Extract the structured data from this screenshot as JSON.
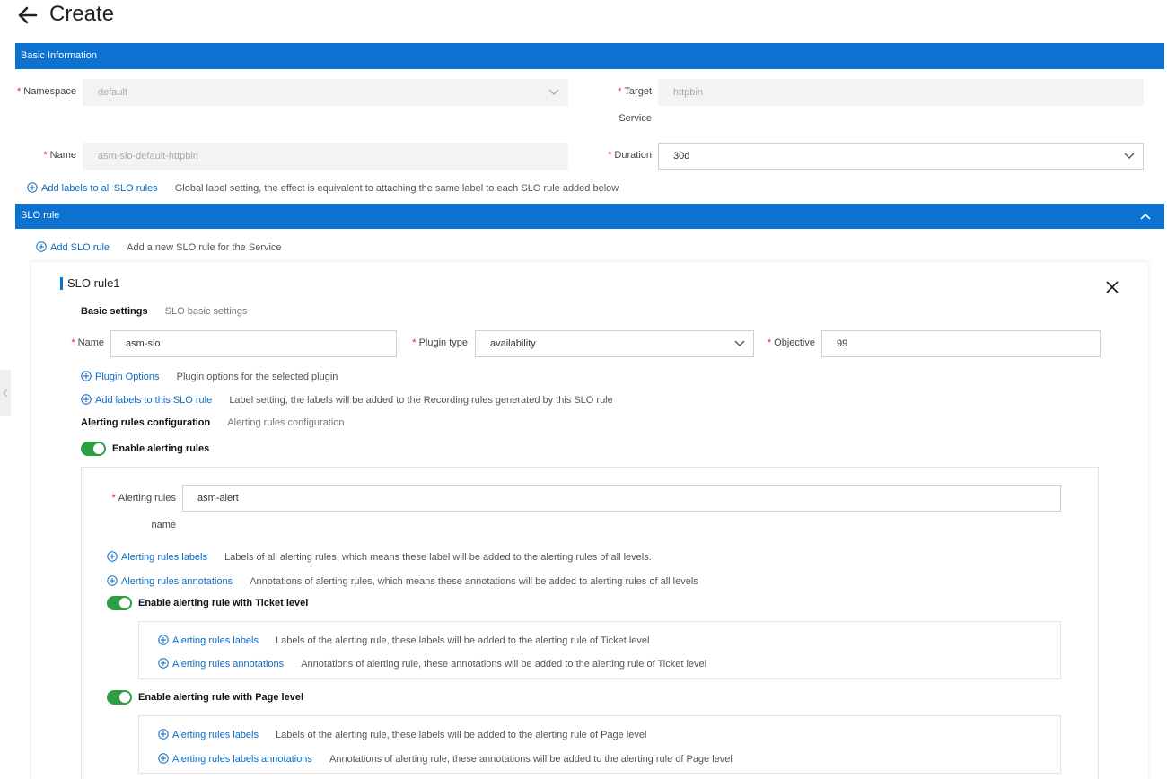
{
  "header": {
    "title": "Create"
  },
  "basic": {
    "band_label": "Basic Information",
    "namespace_label": "Namespace",
    "namespace_value": "default",
    "target_label_line1": "Target",
    "target_label_line2": "Service",
    "target_value": "httpbin",
    "name_label": "Name",
    "name_value": "asm-slo-default-httpbin",
    "duration_label": "Duration",
    "duration_value": "30d",
    "add_labels_link": "Add labels to all SLO rules",
    "add_labels_hint": "Global label setting, the effect is equivalent to attaching the same label to each SLO rule added below"
  },
  "slo": {
    "band_label": "SLO rule",
    "add_link": "Add SLO rule",
    "add_hint": "Add a new SLO rule for the Service",
    "rule": {
      "title": "SLO rule1",
      "basic_settings_title": "Basic settings",
      "basic_settings_hint": "SLO basic settings",
      "name_label": "Name",
      "name_value": "asm-slo",
      "plugin_type_label": "Plugin type",
      "plugin_type_value": "availability",
      "objective_label": "Objective",
      "objective_value": "99",
      "plugin_options_link": "Plugin Options",
      "plugin_options_hint": "Plugin options for the selected plugin",
      "add_labels_link": "Add labels to this SLO rule",
      "add_labels_hint": "Label setting, the labels will be added to the Recording rules generated by this SLO rule",
      "alerting_config_title": "Alerting rules configuration",
      "alerting_config_hint": "Alerting rules configuration",
      "enable_alerting_label": "Enable alerting rules",
      "alerting": {
        "name_label_line1": "Alerting rules",
        "name_label_line2": "name",
        "name_value": "asm-alert",
        "labels_link": "Alerting rules labels",
        "labels_hint": "Labels of all alerting rules, which means these label will be added to the alerting rules of all levels.",
        "annotations_link": "Alerting rules annotations",
        "annotations_hint": "Annotations of alerting rules, which means these annotations will be added to alerting rules of all levels",
        "ticket": {
          "toggle_label": "Enable alerting rule with Ticket level",
          "labels_link": "Alerting rules labels",
          "labels_hint": "Labels of the alerting rule, these labels will be added to the alerting rule of Ticket level",
          "annotations_link": "Alerting rules annotations",
          "annotations_hint": "Annotations of alerting rule, these annotations will be added to the alerting rule of Ticket level"
        },
        "page": {
          "toggle_label": "Enable alerting rule with Page level",
          "labels_link": "Alerting rules labels",
          "labels_hint": "Labels of the alerting rule, these labels will be added to the alerting rule of Page level",
          "annotations_link": "Alerting rules labels annotations",
          "annotations_hint": "Annotations of alerting rule, these annotations will be added to the alerting rule of Page level"
        }
      }
    }
  },
  "colors": {
    "brand": "#0b72d1",
    "link": "#0b6bc4",
    "toggle_on": "#2e9e45",
    "required": "#e02020"
  },
  "icons": [
    "back-arrow-icon",
    "chevron-up-icon",
    "chevron-down-icon",
    "plus-circle-icon",
    "close-icon",
    "chevron-left-icon"
  ]
}
